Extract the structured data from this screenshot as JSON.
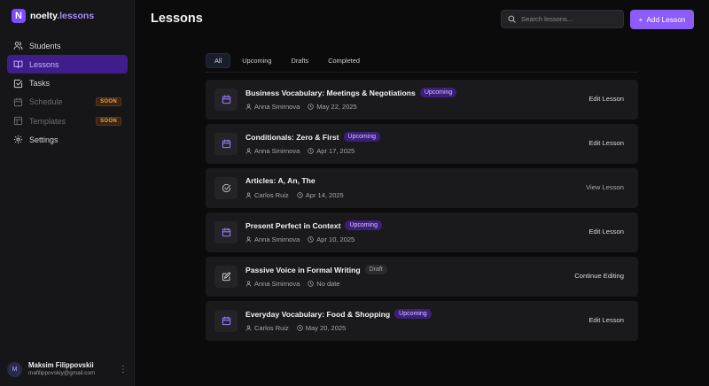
{
  "app": {
    "logo_letter": "N",
    "logo_name": "noelty",
    "logo_suffix": ".lessons"
  },
  "colors": {
    "accent": "#8b5cf6",
    "active_nav": "#3f1d8c",
    "soon": "#e8a24a"
  },
  "sidebar": {
    "items": [
      {
        "label": "Students",
        "icon": "users-icon"
      },
      {
        "label": "Lessons",
        "icon": "book-icon",
        "active": true
      },
      {
        "label": "Tasks",
        "icon": "checkbox-icon"
      },
      {
        "label": "Schedule",
        "icon": "calendar-icon",
        "badge": "SOON"
      },
      {
        "label": "Templates",
        "icon": "template-icon",
        "badge": "SOON"
      },
      {
        "label": "Settings",
        "icon": "gear-icon"
      }
    ],
    "user": {
      "initial": "M",
      "name": "Maksim Filippovskii",
      "email": "mafilippovskiy@gmail.com"
    }
  },
  "header": {
    "title": "Lessons",
    "search_placeholder": "Search lessons...",
    "add_label": "Add Lesson"
  },
  "tabs": [
    "All",
    "Upcoming",
    "Drafts",
    "Completed"
  ],
  "lessons": [
    {
      "title": "Business Vocabulary: Meetings & Negotiations",
      "status": "Upcoming",
      "teacher": "Anna Smirnova",
      "date": "May 22, 2025",
      "action": "Edit Lesson",
      "icon": "calendar-icon"
    },
    {
      "title": "Conditionals: Zero & First",
      "status": "Upcoming",
      "teacher": "Anna Smirnova",
      "date": "Apr 17, 2025",
      "action": "Edit Lesson",
      "icon": "calendar-icon"
    },
    {
      "title": "Articles: A, An, The",
      "status": "",
      "teacher": "Carlos Ruiz",
      "date": "Apr 14, 2025",
      "action": "View Lesson",
      "icon": "check-circle-icon"
    },
    {
      "title": "Present Perfect in Context",
      "status": "Upcoming",
      "teacher": "Anna Smirnova",
      "date": "Apr 10, 2025",
      "action": "Edit Lesson",
      "icon": "calendar-icon"
    },
    {
      "title": "Passive Voice in Formal Writing",
      "status": "Draft",
      "teacher": "Anna Smirnova",
      "date": "No date",
      "action": "Continue Editing",
      "icon": "edit-icon"
    },
    {
      "title": "Everyday Vocabulary: Food & Shopping",
      "status": "Upcoming",
      "teacher": "Carlos Ruiz",
      "date": "May 20, 2025",
      "action": "Edit Lesson",
      "icon": "calendar-icon"
    }
  ]
}
